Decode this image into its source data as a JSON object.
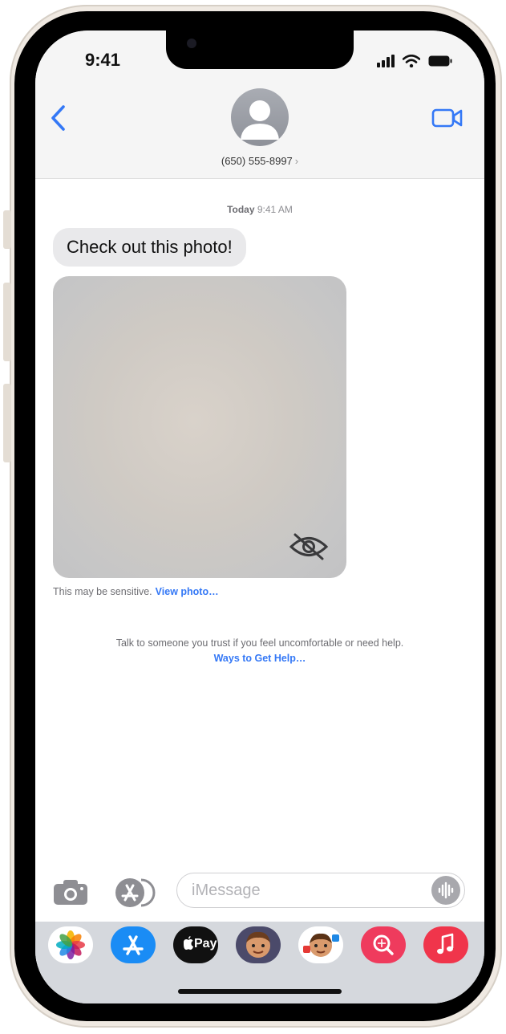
{
  "status_bar": {
    "time": "9:41"
  },
  "header": {
    "contact": "(650) 555-8997",
    "contact_chevron": "›"
  },
  "conversation": {
    "timestamp_day": "Today",
    "timestamp_time": "9:41 AM",
    "message": "Check out this photo!",
    "sensitive_text": "This may be sensitive.",
    "view_photo_link": "View photo…",
    "help_text": "Talk to someone you trust if you feel uncomfortable or need help.",
    "help_link": "Ways to Get Help…"
  },
  "compose": {
    "placeholder": "iMessage"
  },
  "app_strip": {
    "apple_pay_label": "Pay"
  },
  "colors": {
    "accent": "#3478f6",
    "bubble": "#e9e9eb",
    "app_strip": "#d5d8dd",
    "frame": "#efe9e2"
  },
  "icons": [
    "back-chevron-icon",
    "video-call-icon",
    "avatar-icon",
    "signal-icon",
    "wifi-icon",
    "battery-icon",
    "camera-icon",
    "app-store-icon",
    "audio-waveform-icon",
    "eye-slash-icon",
    "photos-app-icon",
    "app-store-app-icon",
    "apple-pay-icon",
    "memoji-icon",
    "memoji-stickers-icon",
    "images-search-icon",
    "music-icon"
  ]
}
